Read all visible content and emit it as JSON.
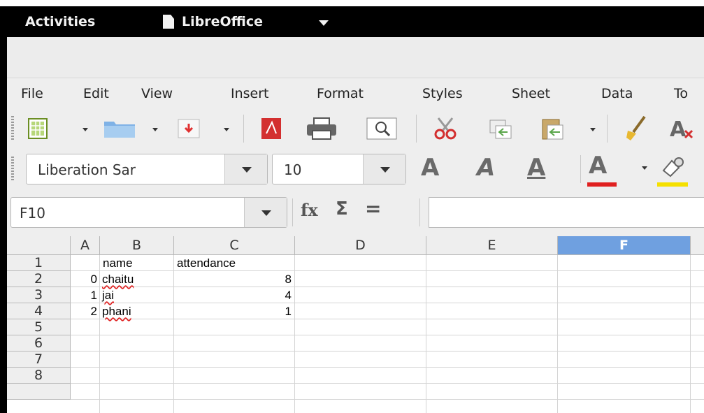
{
  "gnome_bar": {
    "activities": "Activities",
    "app_name": "LibreOffice"
  },
  "menubar": [
    "File",
    "Edit",
    "View",
    "Insert",
    "Format",
    "Styles",
    "Sheet",
    "Data",
    "To"
  ],
  "toolbar2": {
    "font_name": "Liberation Sar",
    "font_size": "10"
  },
  "formula_bar": {
    "name_box": "F10",
    "fx_label": "fx",
    "sigma_label": "Σ",
    "equals_label": "=",
    "input_value": ""
  },
  "sheet": {
    "columns": [
      "A",
      "B",
      "C",
      "D",
      "E",
      "F"
    ],
    "selected_column": "F",
    "rows": [
      "1",
      "2",
      "3",
      "4",
      "5",
      "6",
      "7",
      "8"
    ],
    "cells": [
      [
        "",
        "name",
        "attendance"
      ],
      [
        "0",
        "chaitu",
        "8"
      ],
      [
        "1",
        "jai",
        "4"
      ],
      [
        "2",
        "phani",
        "1"
      ]
    ]
  },
  "colors": {
    "gnome_bar": "#000000",
    "selected_column_header": "#6fa0e0",
    "font_color_bar": "#e02020",
    "highlight_bar": "#f5e000"
  }
}
